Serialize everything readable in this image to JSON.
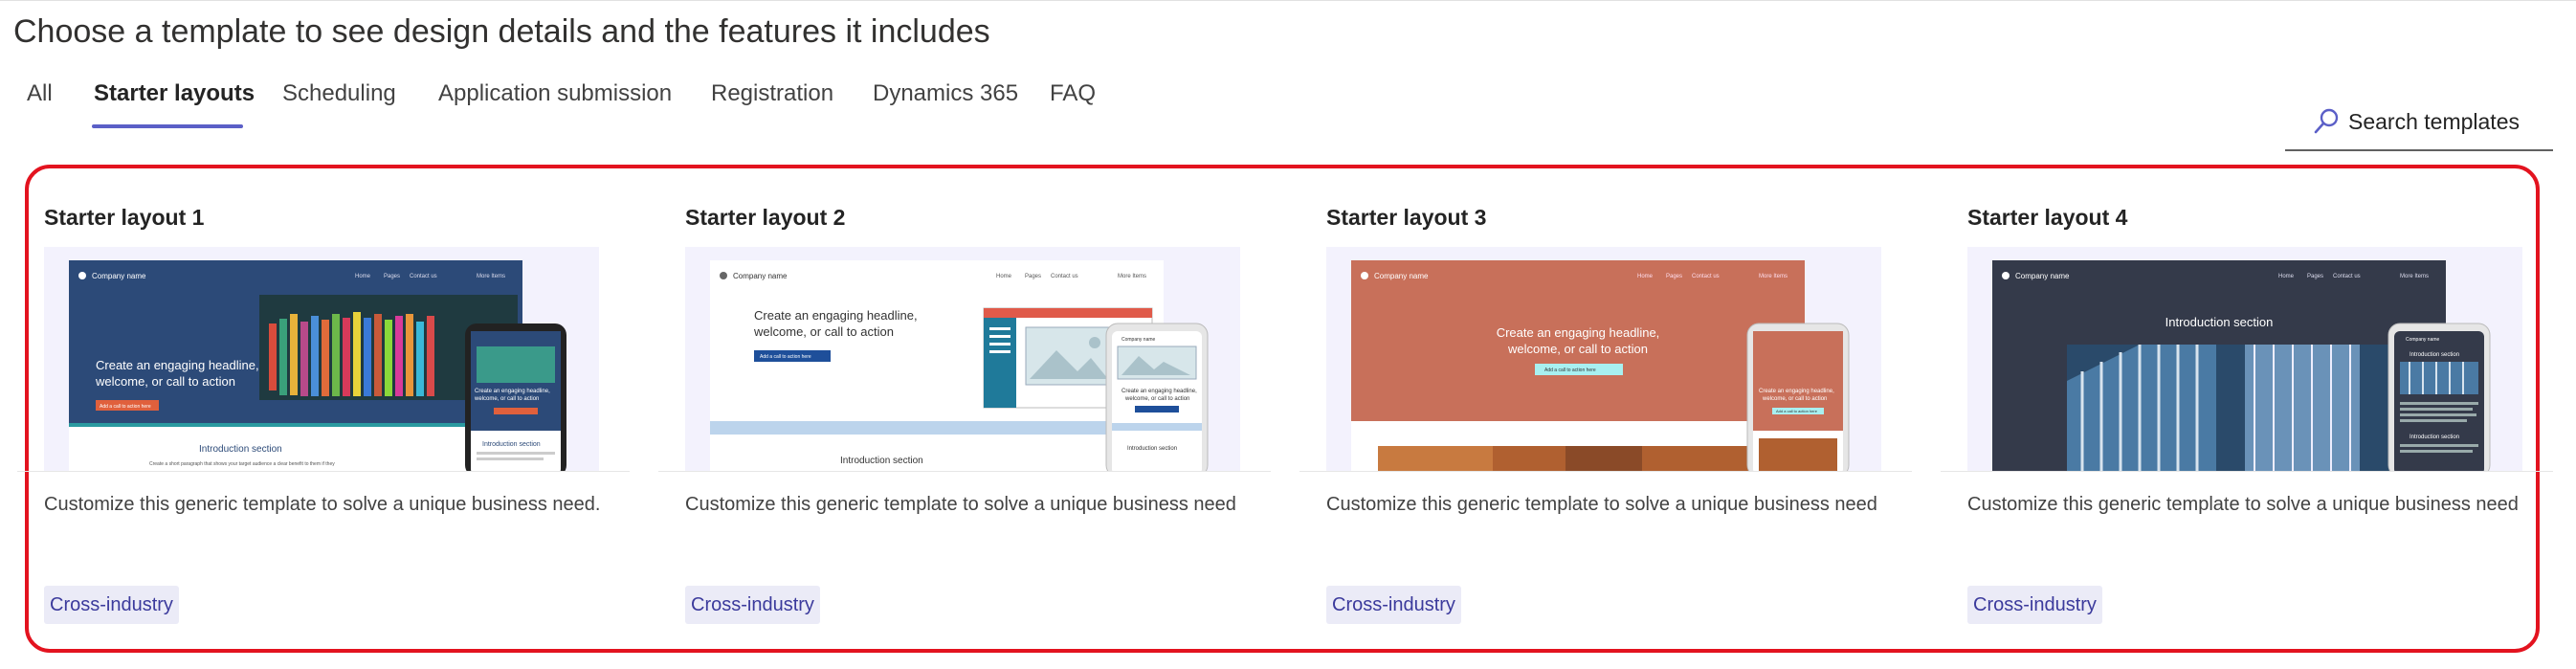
{
  "page": {
    "title": "Choose a template to see design details and the features it includes"
  },
  "tabs": [
    {
      "label": "All"
    },
    {
      "label": "Starter layouts"
    },
    {
      "label": "Scheduling"
    },
    {
      "label": "Application submission"
    },
    {
      "label": "Registration"
    },
    {
      "label": "Dynamics 365"
    },
    {
      "label": "FAQ"
    }
  ],
  "active_tab": "Starter layouts",
  "search": {
    "label": "Search templates",
    "icon": "search-icon"
  },
  "colors": {
    "accent": "#5b5fc7",
    "highlight": "#e3131f",
    "badge_bg": "#ebebf7",
    "badge_text": "#3b3a9c",
    "layout1_header": "#2c4a78",
    "layout3_header": "#c8705a",
    "layout4_header": "#343a4a"
  },
  "cards": [
    {
      "title": "Starter layout 1",
      "description": "Customize this generic template to solve a unique business need.",
      "badge": "Cross-industry",
      "preview": {
        "company": "Company name",
        "nav": [
          "Home",
          "Pages",
          "Contact us",
          "More Items"
        ],
        "headline": "Create an engaging headline, welcome, or call to action",
        "button": "Add a call to action here",
        "section": "Introduction section",
        "section_text": "Create a short paragraph that shows your target audience a clear benefit to them if they",
        "phone_headline": "Create an engaging headline, welcome, or call to action",
        "phone_section": "Introduction section"
      }
    },
    {
      "title": "Starter layout 2",
      "description": "Customize this generic template to solve a unique business need",
      "badge": "Cross-industry",
      "preview": {
        "company": "Company name",
        "nav": [
          "Home",
          "Pages",
          "Contact us",
          "More Items"
        ],
        "headline": "Create an engaging headline, welcome, or call to action",
        "button": "Add a call to action here",
        "section": "Introduction section",
        "phone_company": "Company name",
        "phone_headline": "Create an engaging headline, welcome, or call to action",
        "phone_section": "Introduction section"
      }
    },
    {
      "title": "Starter layout 3",
      "description": "Customize this generic template to solve a unique business need",
      "badge": "Cross-industry",
      "preview": {
        "company": "Company name",
        "nav": [
          "Home",
          "Pages",
          "Contact us",
          "More Items"
        ],
        "headline": "Create an engaging headline, welcome, or call to action",
        "button": "Add a call to action here",
        "phone_headline": "Create an engaging headline, welcome, or call to action",
        "phone_button": "Add a call to action here"
      }
    },
    {
      "title": "Starter layout 4",
      "description": "Customize this generic template to solve a unique business need",
      "badge": "Cross-industry",
      "preview": {
        "company": "Company name",
        "nav": [
          "Home",
          "Pages",
          "Contact us",
          "More Items"
        ],
        "section": "Introduction section",
        "phone_company": "Company name",
        "phone_section": "Introduction section",
        "phone_text": "Create a short paragraph that shows your target audience a clear benefit to them if they continue past this point and offer direction about the next steps"
      }
    }
  ]
}
